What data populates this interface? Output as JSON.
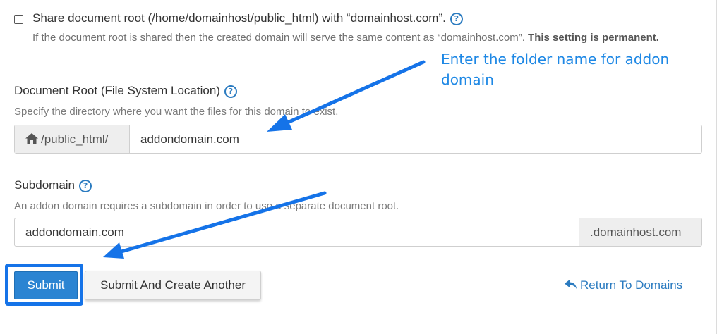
{
  "share": {
    "label": "Share document root (/home/domainhost/public_html) with “domainhost.com”.",
    "help_text": "If the document root is shared then the created domain will serve the same content as “domainhost.com”.",
    "help_bold": "This setting is permanent.",
    "checked": false
  },
  "annotation": {
    "text": "Enter the folder name for addon domain",
    "color": "#1e88e5"
  },
  "document_root": {
    "label": "Document Root (File System Location)",
    "help": "Specify the directory where you want the files for this domain to exist.",
    "prefix": "/public_html/",
    "value": "addondomain.com"
  },
  "subdomain": {
    "label": "Subdomain",
    "help": "An addon domain requires a subdomain in order to use a separate document root.",
    "value": "addondomain.com",
    "suffix": ".domainhost.com"
  },
  "buttons": {
    "submit": "Submit",
    "submit_another": "Submit And Create Another",
    "return": "Return To Domains"
  },
  "icons": {
    "help": "question-circle-icon",
    "home": "home-icon",
    "return": "reply-arrow-icon"
  },
  "colors": {
    "primary": "#2b84d2",
    "link": "#2b7bc0",
    "highlight": "#1573e8"
  }
}
